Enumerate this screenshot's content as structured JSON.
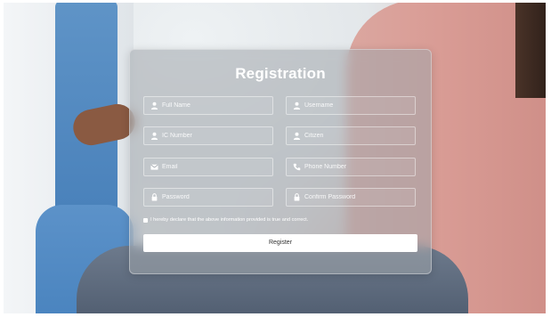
{
  "form": {
    "title": "Registration",
    "fields": {
      "full_name": {
        "placeholder": "Full Name",
        "icon": "user-icon"
      },
      "username": {
        "placeholder": "Username",
        "icon": "user-icon"
      },
      "ic_number": {
        "placeholder": "IC Number",
        "icon": "user-icon"
      },
      "citizen": {
        "placeholder": "Citizen",
        "icon": "user-icon"
      },
      "email": {
        "placeholder": "Email",
        "icon": "envelope-icon"
      },
      "phone_number": {
        "placeholder": "Phone Number",
        "icon": "phone-icon"
      },
      "password": {
        "placeholder": "Password",
        "icon": "lock-icon"
      },
      "confirm_password": {
        "placeholder": "Confirm Password",
        "icon": "lock-icon"
      }
    },
    "declaration": "I hereby declare that the above information provided is true and correct.",
    "register_label": "Register"
  },
  "colors": {
    "card_background": "#a0a5ac",
    "text": "#ffffff",
    "button_background": "#ffffff",
    "button_text": "#333333"
  }
}
